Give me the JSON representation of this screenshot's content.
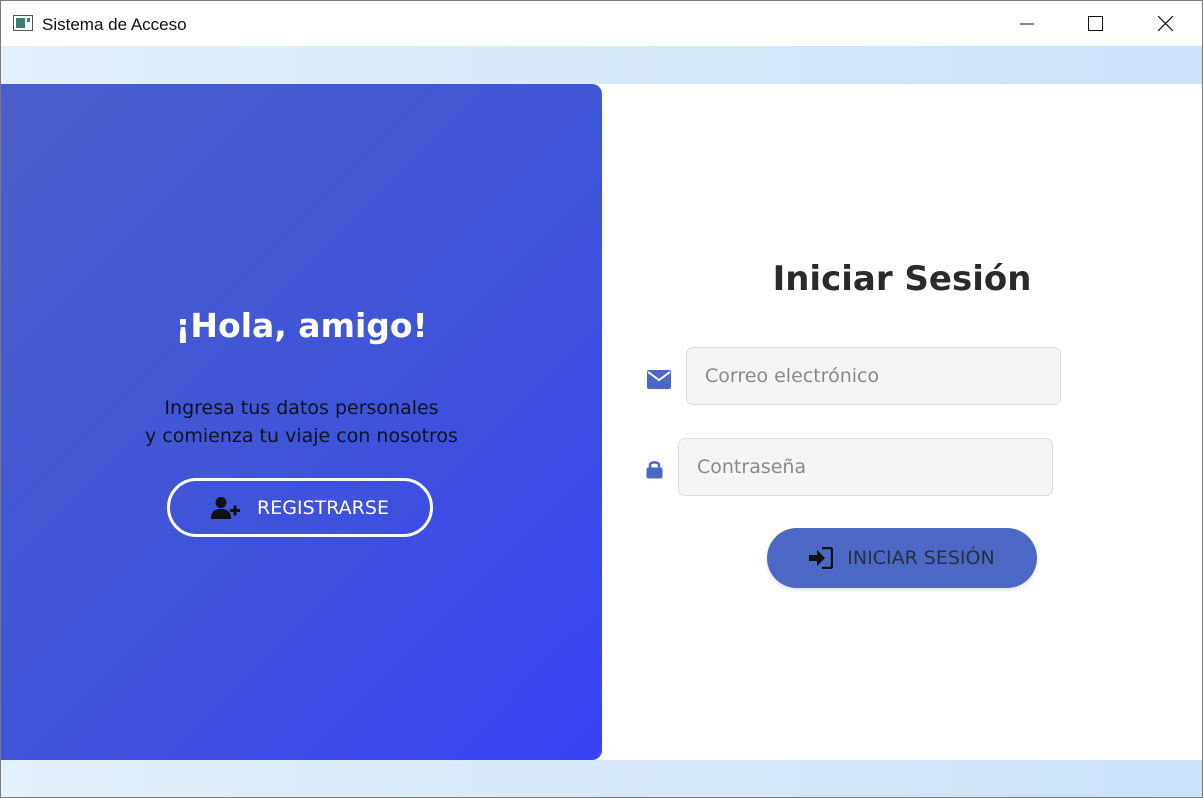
{
  "window": {
    "title": "Sistema de Acceso"
  },
  "welcome": {
    "heading": "¡Hola, amigo!",
    "subtitle_line1": "Ingresa tus datos personales",
    "subtitle_line2": "y comienza tu viaje con nosotros",
    "register_label": "REGISTRARSE"
  },
  "login": {
    "heading": "Iniciar Sesión",
    "email_placeholder": "Correo electrónico",
    "password_placeholder": "Contraseña",
    "submit_label": "INICIAR SESIÓN"
  },
  "colors": {
    "accent": "#4a68c4",
    "panel_gradient_start": "#4a5fc9",
    "panel_gradient_end": "#3843f5",
    "icon_blue": "#4a68c4"
  },
  "icons": {
    "app": "app-window-icon",
    "minimize": "minimize-icon",
    "maximize": "maximize-icon",
    "close": "close-icon",
    "register": "user-plus-icon",
    "email": "envelope-icon",
    "password": "lock-icon",
    "login": "sign-in-icon"
  }
}
